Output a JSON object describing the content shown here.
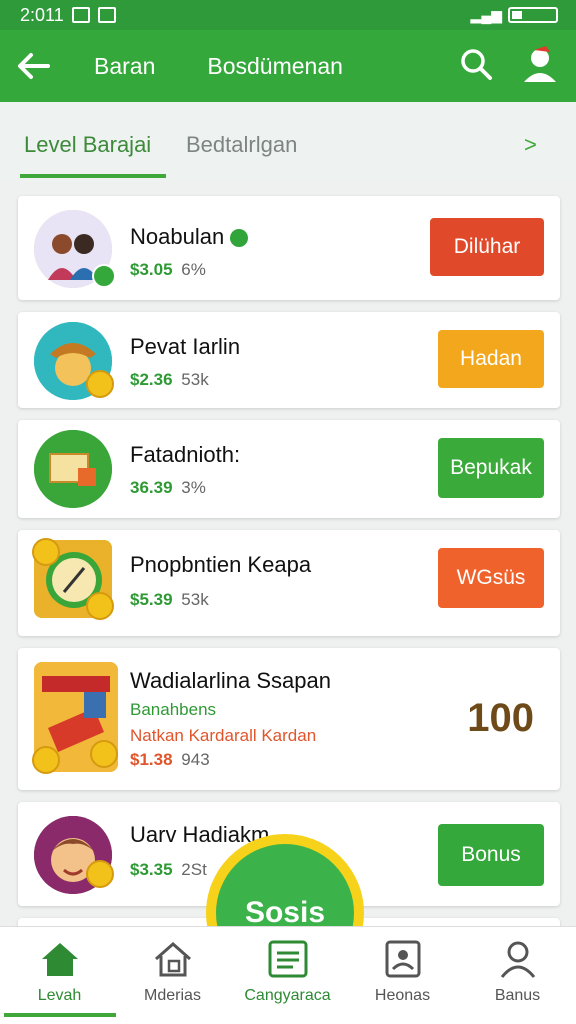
{
  "status": {
    "time": "2:011",
    "icons_right": "signal-wifi-battery"
  },
  "appbar": {
    "title": "Baran",
    "subtitle": "Bosdümenan"
  },
  "tabs": [
    {
      "label": "Level Barajai",
      "active": true
    },
    {
      "label": "Bedtalrlgan",
      "active": false
    }
  ],
  "cards": [
    {
      "title": "Noabulan",
      "price": "$3.05",
      "count": "6%",
      "button": "Dilühar",
      "button_color": "#e0492a"
    },
    {
      "title": "Pevat Iarlin",
      "price": "$2.36",
      "count": "53k",
      "button": "Hadan",
      "button_color": "#f2a71c"
    },
    {
      "title": "Fatadnioth:",
      "price": "36.39",
      "count": "3%",
      "button": "Bepukak",
      "button_color": "#3aab3a"
    },
    {
      "title": "Pnopbntien Keapa",
      "price": "$5.39",
      "count": "53k",
      "button": "WGsüs",
      "button_color": "#f0622c"
    },
    {
      "title": "Wadialarlina Ssapan",
      "sub_green": "Banahbens",
      "sub_red": "Natkan Kardarall Kardan",
      "price": "$1.38",
      "count": "943",
      "big_number": "100"
    },
    {
      "title": "Uarv Hadiakm",
      "price": "$3.35",
      "count": "2St",
      "button": "Bonus",
      "button_color": "#35a83b"
    }
  ],
  "fab": {
    "label": "Sosis"
  },
  "bottom_nav": [
    {
      "label": "Levah",
      "icon": "home-icon",
      "active": true
    },
    {
      "label": "Mderias",
      "icon": "house-edit-icon",
      "active": false
    },
    {
      "label": "Cangyaraca",
      "icon": "list-box-icon",
      "active": false
    },
    {
      "label": "Heonas",
      "icon": "id-card-icon",
      "active": false
    },
    {
      "label": "Banus",
      "icon": "user-icon",
      "active": false
    }
  ],
  "colors": {
    "primary": "#35a83b",
    "status": "#2f9a3a",
    "fab_ring": "#f6d21a"
  }
}
